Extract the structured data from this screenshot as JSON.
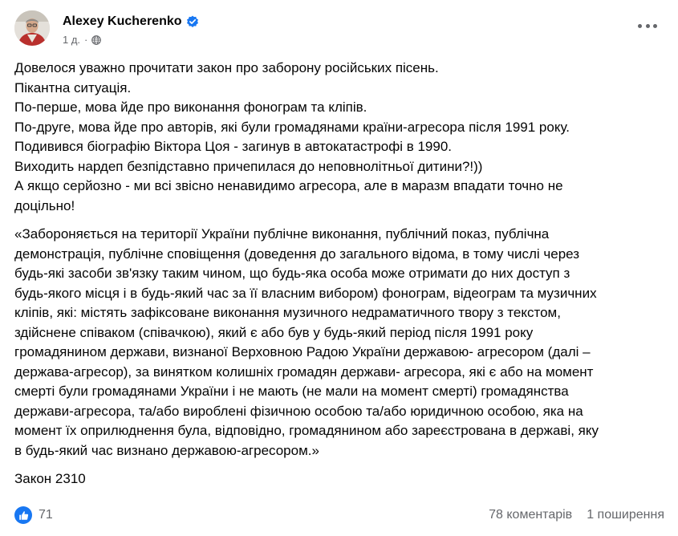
{
  "author": {
    "name": "Alexey Kucherenko",
    "timestamp": "1 д.",
    "separator": "·",
    "verified": true
  },
  "post": {
    "paragraphs": [
      {
        "lines": [
          "Довелося уважно прочитати закон про заборону російських пісень.",
          "Пікантна ситуація.",
          "По-перше, мова йде про виконання фонограм та кліпів.",
          "По-друге, мова йде про авторів, які були громадянами країни-агресора після 1991 року.",
          "Подивився біографію Віктора Цоя - загинув в автокатастрофі в 1990.",
          "Виходить нардеп безпідставно причепилася до неповнолітньої дитини?!))",
          "А якщо серйозно - ми всі звісно ненавидимо агресора, але в маразм впадати точно не",
          "доцільно!"
        ]
      },
      {
        "lines": [
          "«Забороняється на території України публічне виконання, публічний показ, публічна",
          "демонстрація, публічне сповіщення (доведення до загального відома, в тому числі через",
          "будь-які засоби зв'язку таким чином, що будь-яка особа може отримати до них доступ з",
          "будь-якого місця і в будь-який час за її власним вибором) фонограм, відеограм та музичних",
          "кліпів, які: містять зафіксоване виконання музичного недраматичного твору з текстом,",
          "здійснене співаком (співачкою), який є або був у будь-який період після 1991 року",
          "громадянином держави, визнаної Верховною Радою України державою- агресором (далі –",
          "держава-агресор), за винятком колишніх громадян держави- агресора, які є або на момент",
          "смерті були громадянами України і не мають (не мали на момент смерті) громадянства",
          "держави-агресора, та/або вироблені фізичною особою та/або юридичною особою, яка на",
          "момент їх оприлюднення була, відповідно, громадянином або зареєстрована в державі, яку",
          "в будь-який час визнано державою-агресором.»"
        ]
      },
      {
        "lines": [
          "Закон 2310"
        ]
      }
    ]
  },
  "footer": {
    "reactions_count": "71",
    "comments": "78 коментарів",
    "shares": "1 поширення",
    "like_color": "#1877f2"
  },
  "icons": {
    "verified": "verified-badge-icon",
    "audience": "globe-icon",
    "more": "more-options-icon",
    "reaction": "like-reaction-icon"
  }
}
